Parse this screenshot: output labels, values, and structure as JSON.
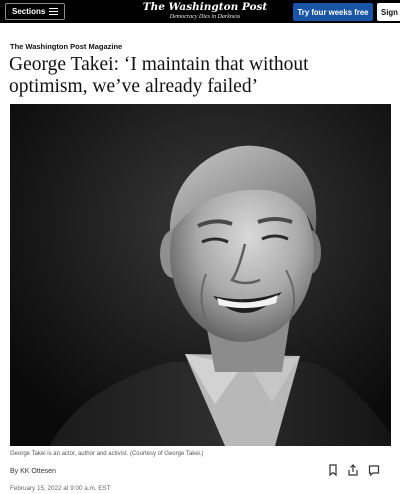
{
  "topbar": {
    "sections_label": "Sections",
    "logo_text": "The Washington Post",
    "tagline": "Democracy Dies in Darkness",
    "trial_button": "Try four weeks free",
    "signin_button": "Sign"
  },
  "article": {
    "kicker": "The Washington Post Magazine",
    "headline": "George Takei: ‘I maintain that without optimism, we’ve already failed’",
    "caption": "George Takei is an actor, author and activist. (Courtesy of George Takei.)",
    "byline_prefix": "By",
    "author": "KK Ottesen",
    "date": "February 15, 2022 at 9:00 a.m. EST"
  },
  "icons": {
    "bookmark": "bookmark-icon",
    "share": "share-icon",
    "comments": "comment-icon",
    "menu": "hamburger-icon"
  },
  "colors": {
    "topbar_bg": "#000000",
    "trial_button_bg": "#1955a5",
    "photo_bg": "#141414"
  }
}
